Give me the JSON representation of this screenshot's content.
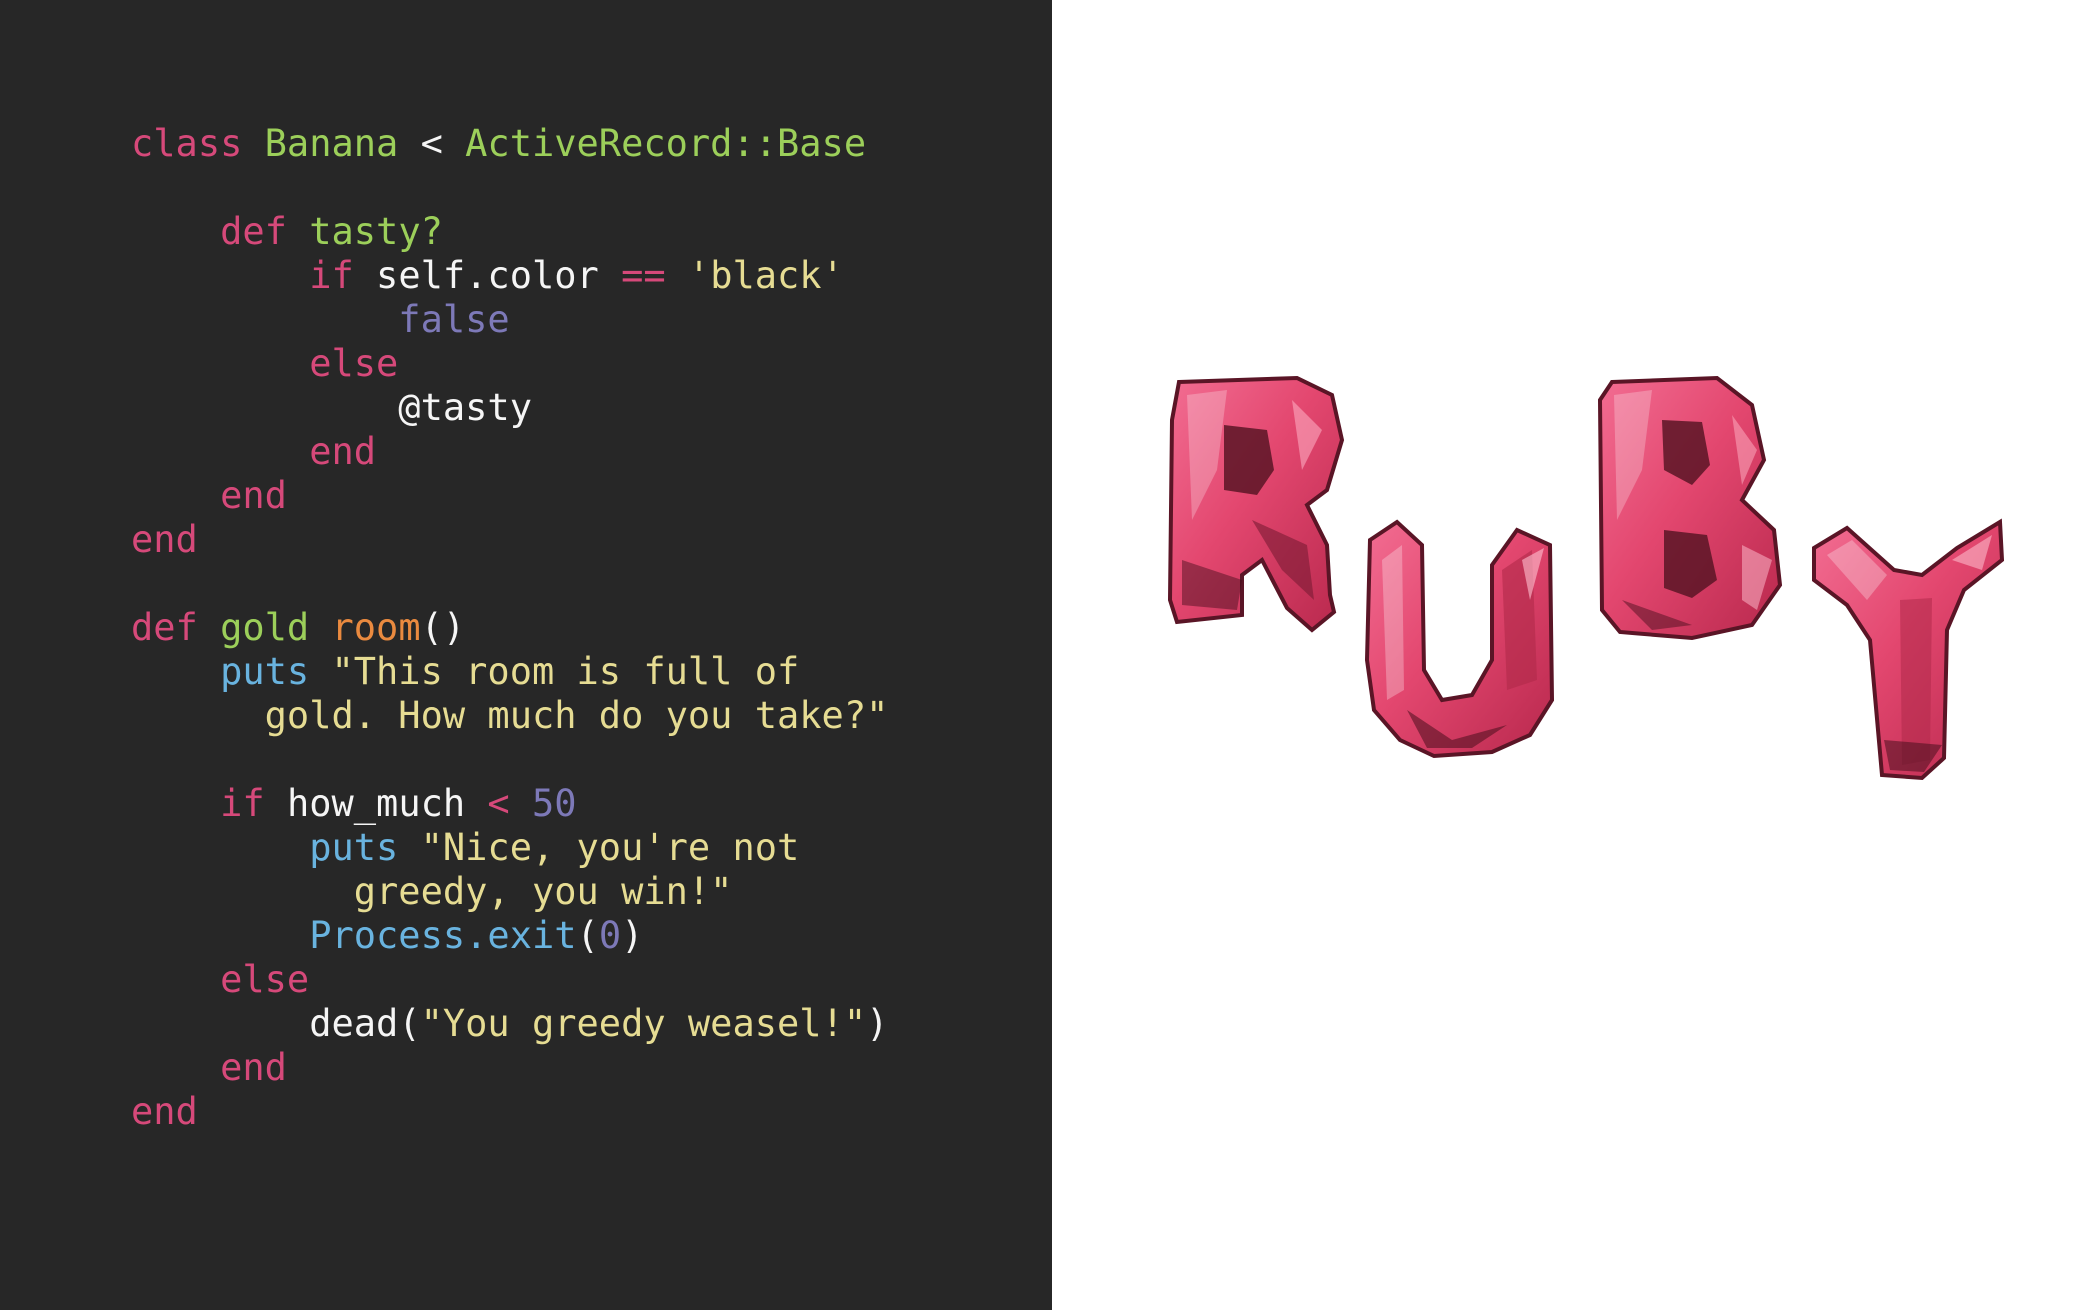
{
  "colors": {
    "background_dark": "#272727",
    "background_light": "#ffffff",
    "keyword": "#d6497a",
    "class_name": "#9ccf5a",
    "string": "#e6dc93",
    "plain": "#f5f5f5",
    "constant": "#7d79b8",
    "builtin_method": "#69b3df",
    "method_name": "#ea8a3f",
    "gem_light": "#ef5f86",
    "gem_mid": "#de3f6a",
    "gem_dark": "#5a1526"
  },
  "code": {
    "lines": [
      [
        {
          "t": "class ",
          "c": "keyword"
        },
        {
          "t": "Banana",
          "c": "class_name"
        },
        {
          "t": " < ",
          "c": "plain"
        },
        {
          "t": "ActiveRecord::Base",
          "c": "class_name"
        }
      ],
      [],
      [
        {
          "t": "    def ",
          "c": "keyword"
        },
        {
          "t": "tasty?",
          "c": "class_name"
        }
      ],
      [
        {
          "t": "        if ",
          "c": "keyword"
        },
        {
          "t": "self.color ",
          "c": "plain"
        },
        {
          "t": "==",
          "c": "keyword"
        },
        {
          "t": " 'black'",
          "c": "string"
        }
      ],
      [
        {
          "t": "            false",
          "c": "constant"
        }
      ],
      [
        {
          "t": "        else",
          "c": "keyword"
        }
      ],
      [
        {
          "t": "            @tasty",
          "c": "plain"
        }
      ],
      [
        {
          "t": "        end",
          "c": "keyword"
        }
      ],
      [
        {
          "t": "    end",
          "c": "keyword"
        }
      ],
      [
        {
          "t": "end",
          "c": "keyword"
        }
      ],
      [],
      [
        {
          "t": "def ",
          "c": "keyword"
        },
        {
          "t": "gold ",
          "c": "class_name"
        },
        {
          "t": "room",
          "c": "method_name"
        },
        {
          "t": "()",
          "c": "plain"
        }
      ],
      [
        {
          "t": "    puts ",
          "c": "builtin_method"
        },
        {
          "t": "\"This room is full of",
          "c": "string"
        }
      ],
      [
        {
          "t": "      gold. How much do you take?\"",
          "c": "string"
        }
      ],
      [],
      [
        {
          "t": "    if ",
          "c": "keyword"
        },
        {
          "t": "how_much ",
          "c": "plain"
        },
        {
          "t": "<",
          "c": "keyword"
        },
        {
          "t": " 50",
          "c": "constant"
        }
      ],
      [
        {
          "t": "        puts ",
          "c": "builtin_method"
        },
        {
          "t": "\"Nice, you're not",
          "c": "string"
        }
      ],
      [
        {
          "t": "          greedy, you win!\"",
          "c": "string"
        }
      ],
      [
        {
          "t": "        Process.exit",
          "c": "builtin_method"
        },
        {
          "t": "(",
          "c": "plain"
        },
        {
          "t": "0",
          "c": "constant"
        },
        {
          "t": ")",
          "c": "plain"
        }
      ],
      [
        {
          "t": "    else",
          "c": "keyword"
        }
      ],
      [
        {
          "t": "        dead",
          "c": "plain"
        },
        {
          "t": "(",
          "c": "plain"
        },
        {
          "t": "\"You greedy weasel!\"",
          "c": "string"
        },
        {
          "t": ")",
          "c": "plain"
        }
      ],
      [
        {
          "t": "    end",
          "c": "keyword"
        }
      ],
      [
        {
          "t": "end",
          "c": "keyword"
        }
      ]
    ]
  },
  "artwork": {
    "title_letters": [
      "R",
      "U",
      "B",
      "Y"
    ],
    "style_label": "faceted red gemstone letters"
  }
}
